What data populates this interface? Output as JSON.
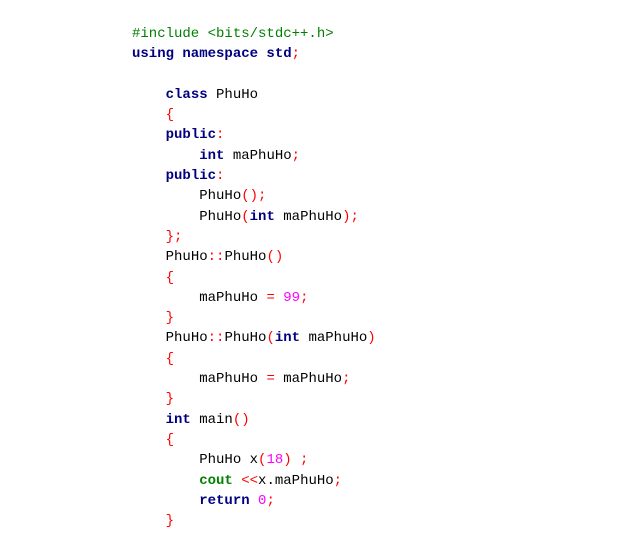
{
  "code": {
    "lines": [
      {
        "indent": "",
        "tokens": [
          {
            "t": "#include <bits/stdc++.h>",
            "k": "preproc"
          }
        ]
      },
      {
        "indent": "",
        "tokens": [
          {
            "t": "using namespace std",
            "k": "keyword"
          },
          {
            "t": ";",
            "k": "punct"
          }
        ]
      },
      {
        "indent": "",
        "tokens": []
      },
      {
        "indent": "    ",
        "tokens": [
          {
            "t": "class",
            "k": "keyword"
          },
          {
            "t": " PhuHo",
            "k": "ident"
          }
        ]
      },
      {
        "indent": "    ",
        "tokens": [
          {
            "t": "{",
            "k": "punct"
          }
        ]
      },
      {
        "indent": "    ",
        "tokens": [
          {
            "t": "public",
            "k": "keyword"
          },
          {
            "t": ":",
            "k": "punct"
          }
        ]
      },
      {
        "indent": "        ",
        "tokens": [
          {
            "t": "int",
            "k": "keyword"
          },
          {
            "t": " maPhuHo",
            "k": "ident"
          },
          {
            "t": ";",
            "k": "punct"
          }
        ]
      },
      {
        "indent": "    ",
        "tokens": [
          {
            "t": "public",
            "k": "keyword"
          },
          {
            "t": ":",
            "k": "punct"
          }
        ]
      },
      {
        "indent": "        ",
        "tokens": [
          {
            "t": "PhuHo",
            "k": "ident"
          },
          {
            "t": "();",
            "k": "punct"
          }
        ]
      },
      {
        "indent": "        ",
        "tokens": [
          {
            "t": "PhuHo",
            "k": "ident"
          },
          {
            "t": "(",
            "k": "punct"
          },
          {
            "t": "int",
            "k": "keyword"
          },
          {
            "t": " maPhuHo",
            "k": "ident"
          },
          {
            "t": ");",
            "k": "punct"
          }
        ]
      },
      {
        "indent": "    ",
        "tokens": [
          {
            "t": "};",
            "k": "punct"
          }
        ]
      },
      {
        "indent": "    ",
        "tokens": [
          {
            "t": "PhuHo",
            "k": "ident"
          },
          {
            "t": "::",
            "k": "punct"
          },
          {
            "t": "PhuHo",
            "k": "ident"
          },
          {
            "t": "()",
            "k": "punct"
          }
        ]
      },
      {
        "indent": "    ",
        "tokens": [
          {
            "t": "{",
            "k": "punct"
          }
        ]
      },
      {
        "indent": "        ",
        "tokens": [
          {
            "t": "maPhuHo ",
            "k": "ident"
          },
          {
            "t": "=",
            "k": "punct"
          },
          {
            "t": " ",
            "k": "ident"
          },
          {
            "t": "99",
            "k": "number"
          },
          {
            "t": ";",
            "k": "punct"
          }
        ]
      },
      {
        "indent": "    ",
        "tokens": [
          {
            "t": "}",
            "k": "punct"
          }
        ]
      },
      {
        "indent": "    ",
        "tokens": [
          {
            "t": "PhuHo",
            "k": "ident"
          },
          {
            "t": "::",
            "k": "punct"
          },
          {
            "t": "PhuHo",
            "k": "ident"
          },
          {
            "t": "(",
            "k": "punct"
          },
          {
            "t": "int",
            "k": "keyword"
          },
          {
            "t": " maPhuHo",
            "k": "ident"
          },
          {
            "t": ")",
            "k": "punct"
          }
        ]
      },
      {
        "indent": "    ",
        "tokens": [
          {
            "t": "{",
            "k": "punct"
          }
        ]
      },
      {
        "indent": "        ",
        "tokens": [
          {
            "t": "maPhuHo ",
            "k": "ident"
          },
          {
            "t": "=",
            "k": "punct"
          },
          {
            "t": " maPhuHo",
            "k": "ident"
          },
          {
            "t": ";",
            "k": "punct"
          }
        ]
      },
      {
        "indent": "    ",
        "tokens": [
          {
            "t": "}",
            "k": "punct"
          }
        ]
      },
      {
        "indent": "    ",
        "tokens": [
          {
            "t": "int",
            "k": "keyword"
          },
          {
            "t": " main",
            "k": "ident"
          },
          {
            "t": "()",
            "k": "punct"
          }
        ]
      },
      {
        "indent": "    ",
        "tokens": [
          {
            "t": "{",
            "k": "punct"
          }
        ]
      },
      {
        "indent": "        ",
        "tokens": [
          {
            "t": "PhuHo x",
            "k": "ident"
          },
          {
            "t": "(",
            "k": "punct"
          },
          {
            "t": "18",
            "k": "number"
          },
          {
            "t": ") ;",
            "k": "punct"
          }
        ]
      },
      {
        "indent": "        ",
        "tokens": [
          {
            "t": "cout",
            "k": "func-green"
          },
          {
            "t": " <<",
            "k": "punct"
          },
          {
            "t": "x",
            "k": "ident"
          },
          {
            "t": ".",
            "k": "dot"
          },
          {
            "t": "maPhuHo",
            "k": "ident"
          },
          {
            "t": ";",
            "k": "punct"
          }
        ]
      },
      {
        "indent": "        ",
        "tokens": [
          {
            "t": "return",
            "k": "keyword"
          },
          {
            "t": " ",
            "k": "ident"
          },
          {
            "t": "0",
            "k": "number"
          },
          {
            "t": ";",
            "k": "punct"
          }
        ]
      },
      {
        "indent": "    ",
        "tokens": [
          {
            "t": "}",
            "k": "punct"
          }
        ]
      }
    ]
  },
  "colors": {
    "preproc": "#008000",
    "keyword": "#000080",
    "punct": "#ff0000",
    "number": "#ff00ff",
    "ident": "#000000",
    "func_green": "#008000"
  }
}
